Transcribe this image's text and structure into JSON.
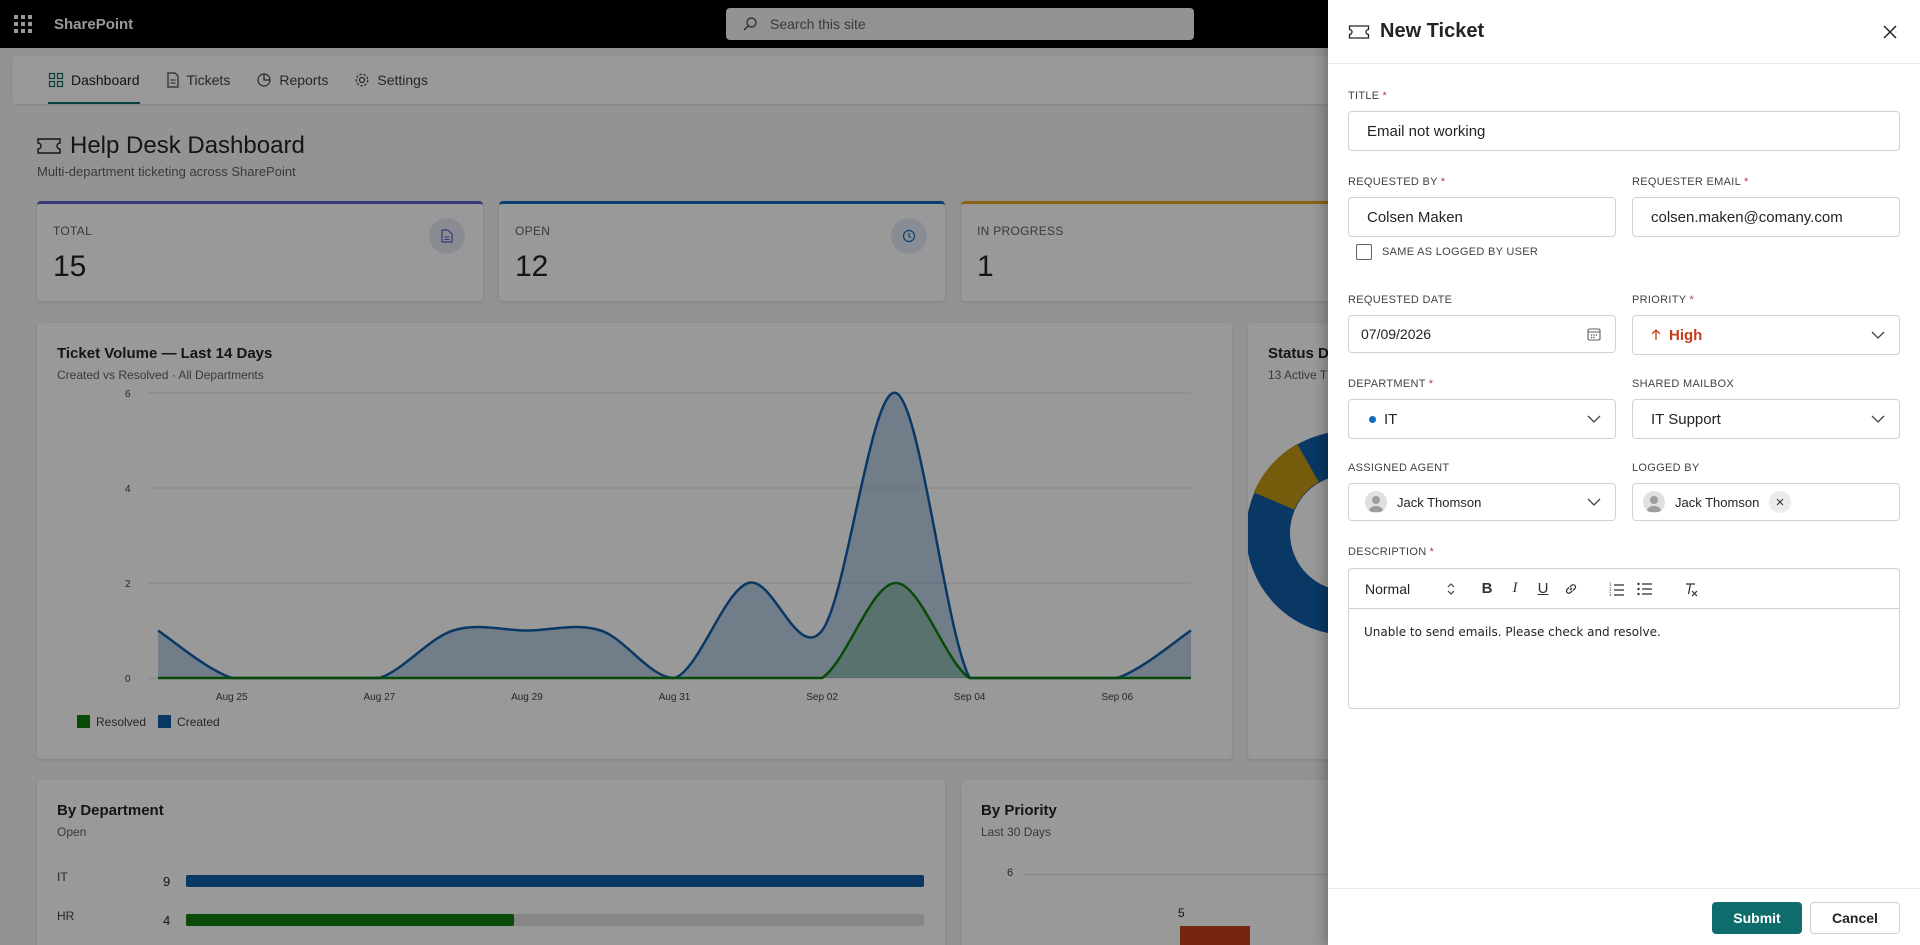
{
  "suite": {
    "brand": "SharePoint",
    "search_placeholder": "Search this site"
  },
  "nav": {
    "tabs": [
      {
        "label": "Dashboard"
      },
      {
        "label": "Tickets"
      },
      {
        "label": "Reports"
      },
      {
        "label": "Settings"
      }
    ]
  },
  "dashboard": {
    "title": "Help Desk Dashboard",
    "subtitle": "Multi-department ticketing across SharePoint",
    "kpis": [
      {
        "label": "TOTAL",
        "value": "15",
        "color": "#5b5fc7"
      },
      {
        "label": "OPEN",
        "value": "12",
        "color": "#0f6cbd"
      },
      {
        "label": "IN PROGRESS",
        "value": "1",
        "color": "#e8a31a"
      }
    ],
    "volume_card": {
      "title": "Ticket Volume — Last 14 Days",
      "subtitle": "Created vs Resolved · All Departments"
    },
    "status_card": {
      "title": "Status D",
      "subtitle": "13 Active T"
    },
    "department_card": {
      "title": "By Department",
      "subtitle": "Open"
    },
    "priority_card": {
      "title": "By Priority",
      "subtitle": "Last 30 Days"
    }
  },
  "chart_data": [
    {
      "type": "area",
      "title": "Ticket Volume — Last 14 Days",
      "x_ticks": [
        "Aug 25",
        "Aug 27",
        "Aug 29",
        "Aug 31",
        "Sep 02",
        "Sep 04",
        "Sep 06"
      ],
      "y_ticks": [
        "0",
        "2",
        "4",
        "6"
      ],
      "ylim": [
        0,
        6
      ],
      "x": [
        "Aug 24",
        "Aug 25",
        "Aug 26",
        "Aug 27",
        "Aug 28",
        "Aug 29",
        "Aug 30",
        "Aug 31",
        "Sep 01",
        "Sep 02",
        "Sep 03",
        "Sep 04",
        "Sep 05",
        "Sep 06",
        "Sep 07"
      ],
      "series": [
        {
          "name": "Created",
          "color": "#0f5ea8",
          "values": [
            1,
            0,
            0,
            0,
            1,
            1,
            1,
            0,
            2,
            1,
            6,
            0,
            0,
            0,
            1
          ]
        },
        {
          "name": "Resolved",
          "color": "#107c10",
          "values": [
            0,
            0,
            0,
            0,
            0,
            0,
            0,
            0,
            0,
            0,
            2,
            0,
            0,
            0,
            0
          ]
        }
      ],
      "legend": [
        "Resolved",
        "Created"
      ]
    },
    {
      "type": "bar",
      "title": "By Department",
      "categories": [
        "IT",
        "HR"
      ],
      "values": [
        9,
        4
      ],
      "max": 9,
      "colors": [
        "#0f5ea8",
        "#107c10"
      ]
    },
    {
      "type": "bar",
      "title": "By Priority",
      "y_ticks": [
        "6"
      ],
      "values": [
        5
      ],
      "colors": [
        "#c43e1c"
      ]
    }
  ],
  "panel": {
    "title": "New Ticket",
    "title_label": "TITLE",
    "title_value": "Email not working",
    "requested_by_label": "REQUESTED BY",
    "requested_by_value": "Colsen Maken",
    "requester_email_label": "REQUESTER EMAIL",
    "requester_email_value": "colsen.maken@comany.com",
    "same_as_label": "SAME AS LOGGED BY USER",
    "requested_date_label": "REQUESTED DATE",
    "requested_date_value": "07/09/2026",
    "priority_label": "PRIORITY",
    "priority_value": "High",
    "priority_color": "#c43e1c",
    "department_label": "DEPARTMENT",
    "department_value": "IT",
    "department_color": "#0f6cbd",
    "shared_mailbox_label": "SHARED MAILBOX",
    "shared_mailbox_value": "IT Support",
    "assigned_agent_label": "ASSIGNED AGENT",
    "assigned_agent_value": "Jack Thomson",
    "logged_by_label": "LOGGED BY",
    "logged_by_value": "Jack Thomson",
    "description_label": "DESCRIPTION",
    "editor_format": "Normal",
    "description_value": "Unable to send emails. Please check and resolve.",
    "submit_label": "Submit",
    "cancel_label": "Cancel",
    "accent": "#0f6c6c"
  }
}
